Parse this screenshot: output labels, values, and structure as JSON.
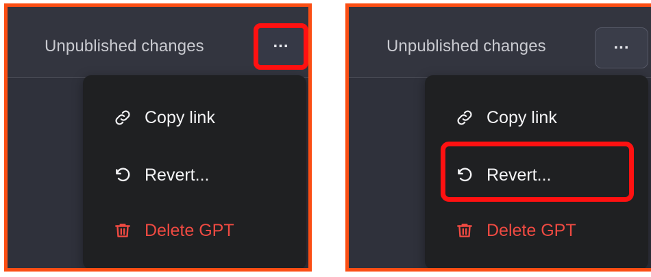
{
  "panels": [
    {
      "status_text": "Unpublished changes",
      "more_button_label": "...",
      "menu": {
        "items": [
          {
            "label": "Copy link",
            "icon": "link-icon"
          },
          {
            "label": "Revert...",
            "icon": "revert-icon"
          },
          {
            "label": "Delete GPT",
            "icon": "trash-icon"
          }
        ]
      },
      "highlight": "more-button"
    },
    {
      "status_text": "Unpublished changes",
      "more_button_label": "...",
      "menu": {
        "items": [
          {
            "label": "Copy link",
            "icon": "link-icon"
          },
          {
            "label": "Revert...",
            "icon": "revert-icon"
          },
          {
            "label": "Delete GPT",
            "icon": "trash-icon"
          }
        ]
      },
      "highlight": "revert-menu-item"
    }
  ],
  "colors": {
    "frame": "#fb4e14",
    "highlight": "#ff1111",
    "panel_bg": "#33353f",
    "menu_bg": "#1f2022",
    "danger": "#ef4a42"
  }
}
